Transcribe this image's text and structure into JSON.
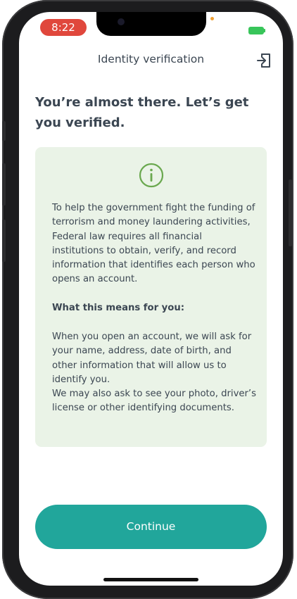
{
  "status_bar": {
    "time": "8:22"
  },
  "header": {
    "title": "Identity verification",
    "exit_icon": "logout-icon"
  },
  "headline": "You’re almost there. Let’s get you verified.",
  "info_card": {
    "icon": "info-icon",
    "paragraph_1": "To help the government fight the funding of terrorism and money laundering activities, Federal law requires all financial institutions to obtain, verify, and record information that identifies each person who opens an account.",
    "subheading": "What this means for you:",
    "paragraph_2": "When you open an account, we will ask for your name, address, date of birth, and other information that will allow us to identify you.",
    "paragraph_3": "We may also ask to see your photo, driver’s license or other identifying documents."
  },
  "continue_button": {
    "label": "Continue"
  },
  "colors": {
    "accent": "#21a69b",
    "card_background": "#eaf3e7",
    "icon_green": "#6aa84f",
    "text": "#3b4652"
  }
}
